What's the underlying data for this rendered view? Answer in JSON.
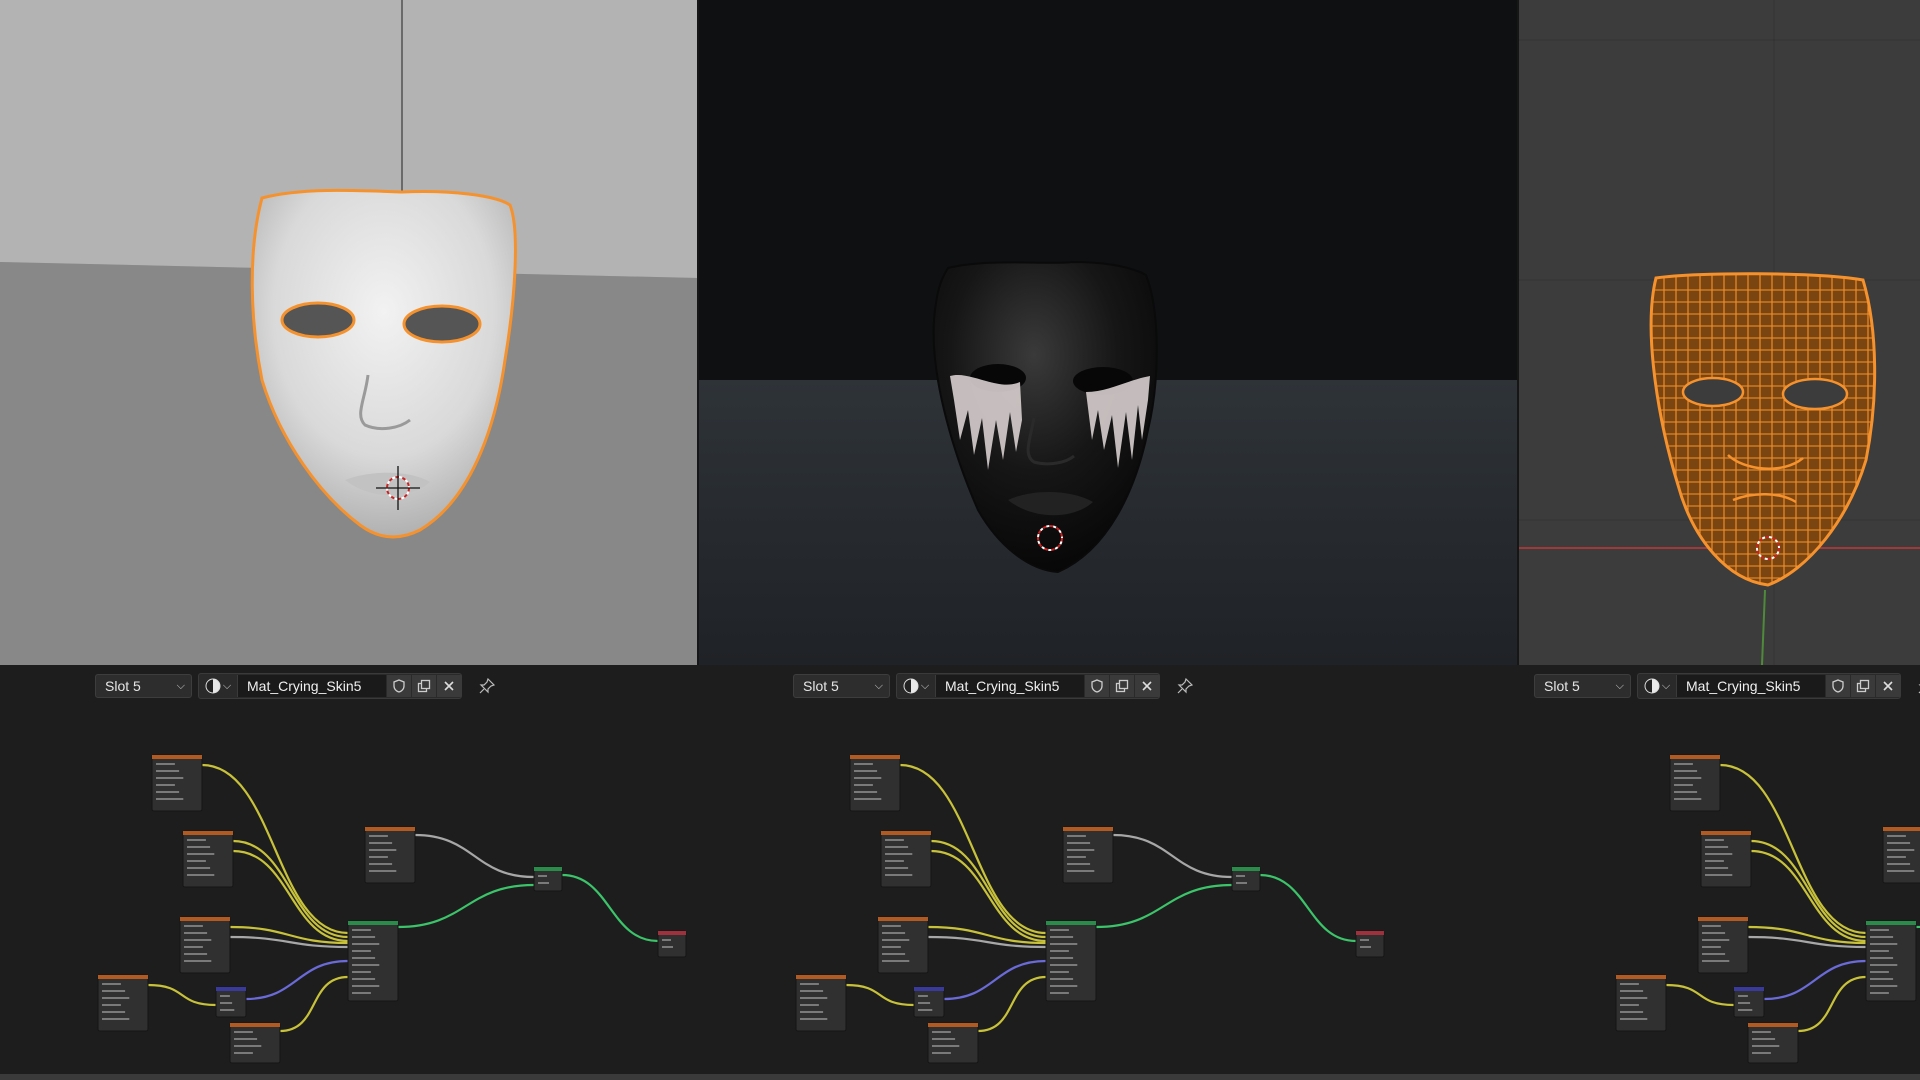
{
  "editors": [
    {
      "slot_label": "Slot 5",
      "material_name": "Mat_Crying_Skin5"
    },
    {
      "slot_label": "Slot 5",
      "material_name": "Mat_Crying_Skin5"
    },
    {
      "slot_label": "Slot 5",
      "material_name": "Mat_Crying_Skin5"
    }
  ],
  "icons": {
    "slot_dropdown": "chevron-down-icon",
    "material_browse": "material-sphere-icon",
    "fake_user": "shield-icon",
    "duplicate": "duplicate-icon",
    "unlink": "close-icon",
    "pin": "pin-icon"
  },
  "viewports": [
    {
      "mode": "solid",
      "object": "mask"
    },
    {
      "mode": "rendered",
      "object": "mask"
    },
    {
      "mode": "wireframe",
      "object": "mask"
    }
  ],
  "colors": {
    "selection_outline": "#f5922d",
    "link_yellow": "#c8c23a",
    "link_gray": "#a7a7a7",
    "link_green": "#3cc46a",
    "link_blue": "#6a6ad8",
    "node_header_orange": "#b35a20",
    "node_header_green": "#2a8c4a",
    "node_header_blue": "#3a3a9c",
    "node_header_red": "#a0303c"
  }
}
